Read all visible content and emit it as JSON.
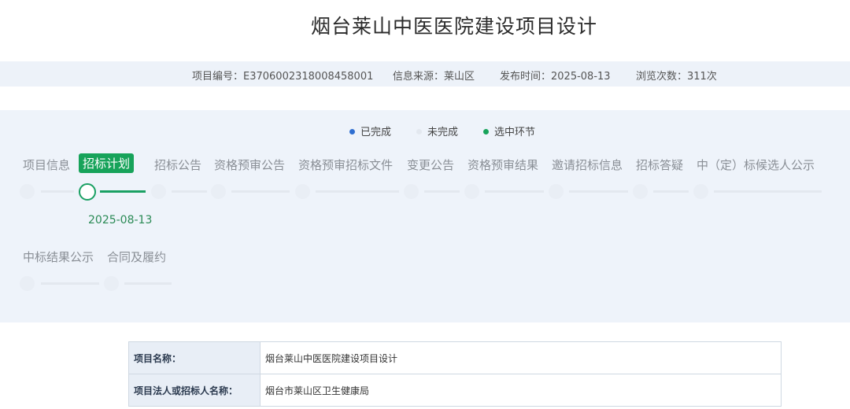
{
  "page": {
    "title": "烟台莱山中医医院建设项目设计"
  },
  "meta": {
    "project_no": "项目编号：E3706002318008458001",
    "source": "信息来源：莱山区",
    "publish_time": "发布时间：2025-08-13",
    "views": "浏览次数：311次"
  },
  "legend": {
    "done": "已完成",
    "undone": "未完成",
    "selected": "选中环节",
    "colors": {
      "done": "#2f6fd1",
      "undone": "#e3e8ef",
      "selected": "#17a35a"
    }
  },
  "steps": [
    {
      "label": "项目信息",
      "state": "undone"
    },
    {
      "label": "招标计划",
      "state": "selected",
      "date": "2025-08-13"
    },
    {
      "label": "招标公告",
      "state": "undone"
    },
    {
      "label": "资格预审公告",
      "state": "undone"
    },
    {
      "label": "资格预审招标文件",
      "state": "undone"
    },
    {
      "label": "变更公告",
      "state": "undone"
    },
    {
      "label": "资格预审结果",
      "state": "undone"
    },
    {
      "label": "邀请招标信息",
      "state": "undone"
    },
    {
      "label": "招标答疑",
      "state": "undone"
    },
    {
      "label": "中（定）标候选人公示",
      "state": "undone"
    },
    {
      "label": "中标结果公示",
      "state": "undone"
    },
    {
      "label": "合同及履约",
      "state": "undone"
    }
  ],
  "table": {
    "rows": [
      {
        "key": "项目名称：",
        "value": "烟台莱山中医医院建设项目设计"
      },
      {
        "key": "项目法人或招标人名称：",
        "value": "烟台市莱山区卫生健康局"
      }
    ]
  }
}
